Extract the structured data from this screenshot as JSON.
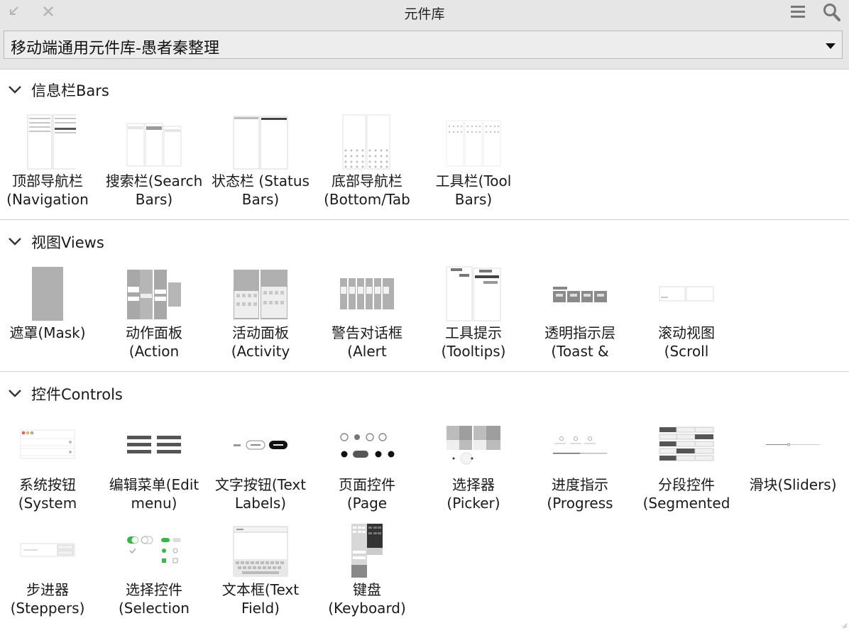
{
  "window": {
    "title": "元件库"
  },
  "library": {
    "selected": "移动端通用元件库-愚者秦整理"
  },
  "sections": {
    "bars": {
      "title": "信息栏Bars",
      "items": [
        {
          "line1": "顶部导航栏",
          "line2": "(Navigation"
        },
        {
          "line1": "搜索栏(Search",
          "line2": "Bars)"
        },
        {
          "line1": "状态栏 (Status",
          "line2": "Bars)"
        },
        {
          "line1": "底部导航栏",
          "line2": "(Bottom/Tab"
        },
        {
          "line1": "工具栏(Tool",
          "line2": "Bars)"
        }
      ]
    },
    "views": {
      "title": "视图Views",
      "items": [
        {
          "line1": "遮罩(Mask)",
          "line2": ""
        },
        {
          "line1": "动作面板",
          "line2": "(Action"
        },
        {
          "line1": "活动面板",
          "line2": "(Activity"
        },
        {
          "line1": "警告对话框",
          "line2": "(Alert"
        },
        {
          "line1": "工具提示",
          "line2": "(Tooltips)"
        },
        {
          "line1": "透明指示层",
          "line2": "(Toast &"
        },
        {
          "line1": "滚动视图",
          "line2": "(Scroll"
        }
      ]
    },
    "controls": {
      "title": "控件Controls",
      "items": [
        {
          "line1": "系统按钮",
          "line2": "(System"
        },
        {
          "line1": "编辑菜单(Edit",
          "line2": "menu)"
        },
        {
          "line1": "文字按钮(Text",
          "line2": "Labels)"
        },
        {
          "line1": "页面控件",
          "line2": "(Page"
        },
        {
          "line1": "选择器",
          "line2": "(Picker)"
        },
        {
          "line1": "进度指示",
          "line2": "(Progress"
        },
        {
          "line1": "分段控件",
          "line2": "(Segmented"
        },
        {
          "line1": "滑块(Sliders)",
          "line2": ""
        },
        {
          "line1": "步进器",
          "line2": "(Steppers)"
        },
        {
          "line1": "选择控件",
          "line2": "(Selection"
        },
        {
          "line1": "文本框(Text",
          "line2": "Field)"
        },
        {
          "line1": "键盘",
          "line2": "(Keyboard)"
        }
      ]
    }
  }
}
